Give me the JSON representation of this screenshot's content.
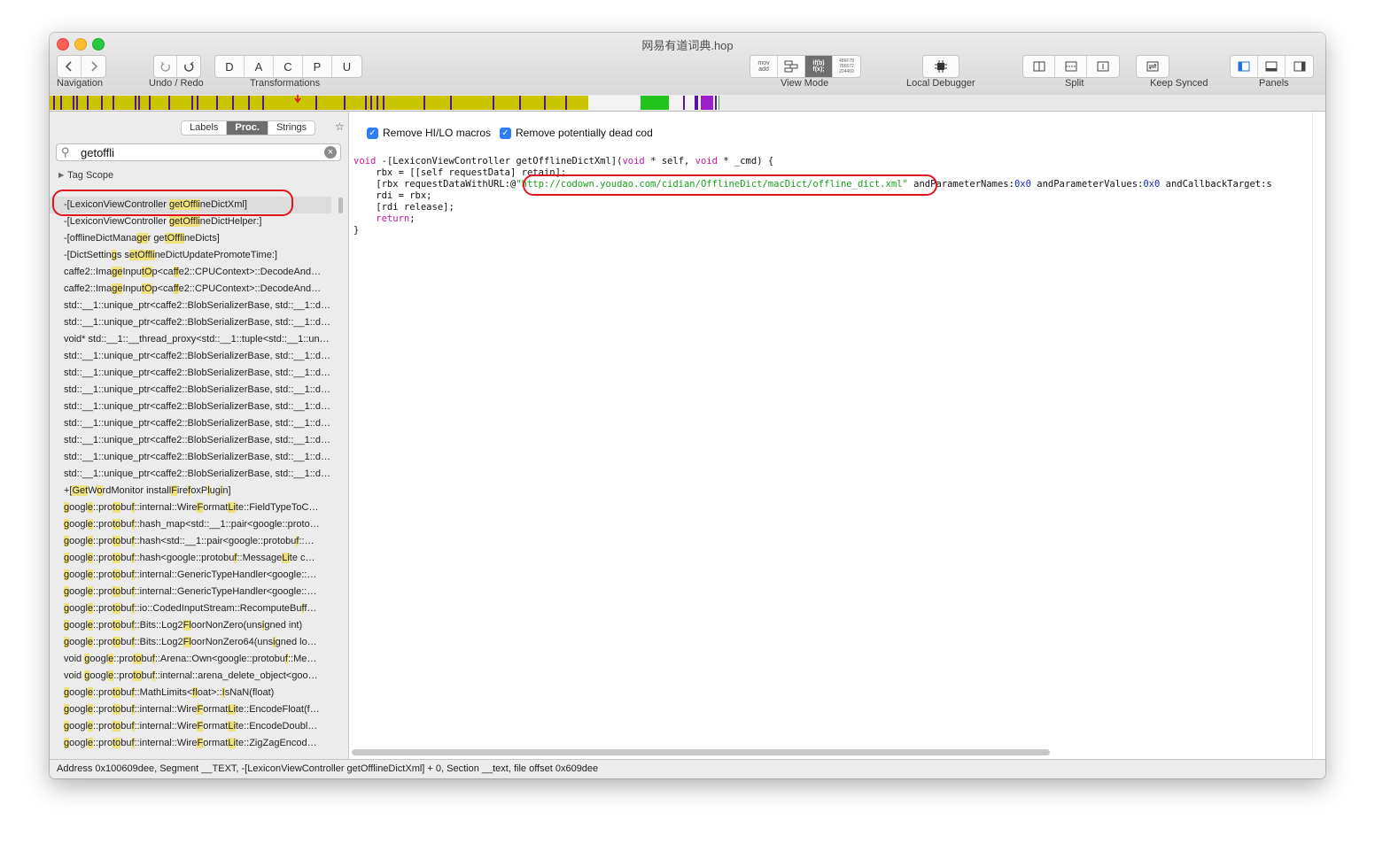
{
  "window": {
    "title": "网易有道词典.hop"
  },
  "toolbar": {
    "navigation_label": "Navigation",
    "undo_redo_label": "Undo / Redo",
    "transformations_label": "Transformations",
    "transform_buttons": [
      "D",
      "A",
      "C",
      "P",
      "U"
    ],
    "view_mode_label": "View Mode",
    "view_mode_asm": "mov add",
    "view_mode_pseudo": "if(b) f(x);",
    "view_mode_hex": "486F78 786572 204469",
    "local_debugger_label": "Local Debugger",
    "split_label": "Split",
    "keep_synced_label": "Keep Synced",
    "panels_label": "Panels"
  },
  "sidebar": {
    "tabs": [
      "Labels",
      "Proc.",
      "Strings"
    ],
    "selected_tab": "Proc.",
    "search": {
      "value": "getoffli"
    },
    "tag_scope": "Tag Scope",
    "items": [
      "-[LexiconViewController getOfflineDictXml]",
      "-[LexiconViewController getOfflineDictHelper:]",
      "-[offlineDictManager getOfflineDicts]",
      "-[DictSettings setOfflineDictUpdatePromoteTime:]",
      "caffe2::ImageInputOp<caffe2::CPUContext>::DecodeAnd…",
      "caffe2::ImageInputOp<caffe2::CPUContext>::DecodeAnd…",
      "std::__1::unique_ptr<caffe2::BlobSerializerBase, std::__1::d…",
      "std::__1::unique_ptr<caffe2::BlobSerializerBase, std::__1::d…",
      "void* std::__1::__thread_proxy<std::__1::tuple<std::__1::uni…",
      "std::__1::unique_ptr<caffe2::BlobSerializerBase, std::__1::d…",
      "std::__1::unique_ptr<caffe2::BlobSerializerBase, std::__1::d…",
      "std::__1::unique_ptr<caffe2::BlobSerializerBase, std::__1::d…",
      "std::__1::unique_ptr<caffe2::BlobSerializerBase, std::__1::d…",
      "std::__1::unique_ptr<caffe2::BlobSerializerBase, std::__1::d…",
      "std::__1::unique_ptr<caffe2::BlobSerializerBase, std::__1::d…",
      "std::__1::unique_ptr<caffe2::BlobSerializerBase, std::__1::d…",
      "std::__1::unique_ptr<caffe2::BlobSerializerBase, std::__1::d…",
      "+[GetWordMonitor installFirefoxPlugin]",
      "google::protobuf::internal::WireFormatLite::FieldTypeToC…",
      "google::protobuf::hash_map<std::__1::pair<google::proto…",
      "google::protobuf::hash<std::__1::pair<google::protobuf::…",
      "google::protobuf::hash<google::protobuf::MessageLite c…",
      "google::protobuf::internal::GenericTypeHandler<google::…",
      "google::protobuf::internal::GenericTypeHandler<google::…",
      "google::protobuf::io::CodedInputStream::RecomputeBuff…",
      "google::protobuf::Bits::Log2FloorNonZero(unsigned int)",
      "google::protobuf::Bits::Log2FloorNonZero64(unsigned lo…",
      "void google::protobuf::Arena::Own<google::protobuf::Me…",
      "void google::protobuf::internal::arena_delete_object<goo…",
      "google::protobuf::MathLimits<float>::IsNaN(float)",
      "google::protobuf::internal::WireFormatLite::EncodeFloat(f…",
      "google::protobuf::internal::WireFormatLite::EncodeDoubl…",
      "google::protobuf::internal::WireFormatLite::ZigZagEncod…"
    ]
  },
  "editor": {
    "options": [
      "Remove HI/LO macros",
      "Remove potentially dead cod"
    ],
    "code": {
      "line1_kw_void": "void",
      "line1_sig": " -[LexiconViewController getOfflineDictXml](",
      "line1_kw_void2": "void",
      "line1_mid": " * self, ",
      "line1_kw_void3": "void",
      "line1_end": " * _cmd) {",
      "line2": "    rbx = [[self requestData] retain];",
      "line3_pre": "    [rbx requestDataWithURL:@",
      "line3_url": "\"http://codown.youdao.com/cidian/OfflineDict/macDict/offline_dict.xml\"",
      "line3_a": " andParameterNames:",
      "line3_n1": "0x0",
      "line3_b": " andParameterValues:",
      "line3_n2": "0x0",
      "line3_c": " andCallbackTarget:s",
      "line4": "    rdi = rbx;",
      "line5": "    [rdi release];",
      "line6_kw": "return",
      "line6_end": ";",
      "line7": "}"
    }
  },
  "status": {
    "text": "Address 0x100609dee, Segment __TEXT, -[LexiconViewController getOfflineDictXml] + 0, Section __text, file offset 0x609dee"
  },
  "colors": {
    "keyword": "#c4189c",
    "string": "#16a316",
    "number": "#1d2bb7",
    "selected_tab": "#6e6e6e",
    "annotation": "#e0141e"
  }
}
